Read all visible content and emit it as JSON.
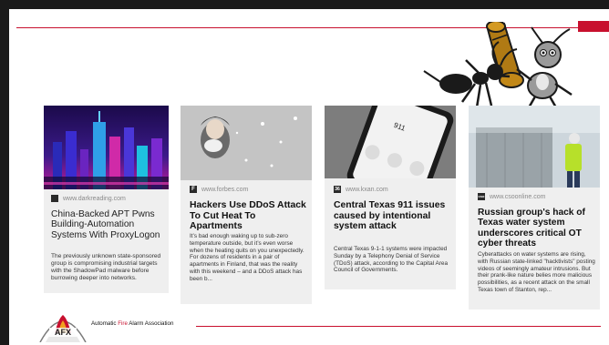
{
  "cards": [
    {
      "source": "www.darkreading.com",
      "title": "China-Backed APT Pwns Building-Automation Systems With ProxyLogon",
      "body": "The previously unknown state-sponsored group is compromising industrial targets with the ShadowPad malware before burrowing deeper into networks.",
      "favicon": "dark-reading-icon"
    },
    {
      "source": "www.forbes.com",
      "title": "Hackers Use DDoS Attack To Cut Heat To Apartments",
      "body": "It’s bad enough waking up to sub-zero temperature outside, but it’s even worse when the heating quits on you unexpectedly. For dozens of residents in a pair of apartments in Finland, that was the reality with this weekend – and a DDoS attack has been b...",
      "favicon": "forbes-icon",
      "favicon_text": "F"
    },
    {
      "source": "www.kxan.com",
      "title": "Central Texas 911 issues caused by intentional system attack",
      "body": "Central Texas 9-1-1 systems were impacted Sunday by a Telephony Denial of Service (TDoS) attack, according to the Capital Area Council of Governments.",
      "favicon": "kxan-icon",
      "favicon_text": "36"
    },
    {
      "source": "www.csoonline.com",
      "title": "Russian group's hack of Texas water system underscores critical OT cyber threats",
      "body": "Cyberattacks on water systems are rising, with Russian state-linked \"hacktivists\" posting videos of seemingly amateur intrusions. But their prank-like nature belies more malicious possibilities, as a recent attack on the small Texas town of Stanton, rep...",
      "favicon": "cso-icon",
      "favicon_text": "cso"
    }
  ],
  "footer": {
    "org_prefix": "Automatic ",
    "org_fire": "Fire",
    "org_suffix": " Alarm Association",
    "logo_text": "AFX"
  },
  "colors": {
    "accent": "#c8102e",
    "bar": "#1a1a1a",
    "card": "#efefef"
  }
}
